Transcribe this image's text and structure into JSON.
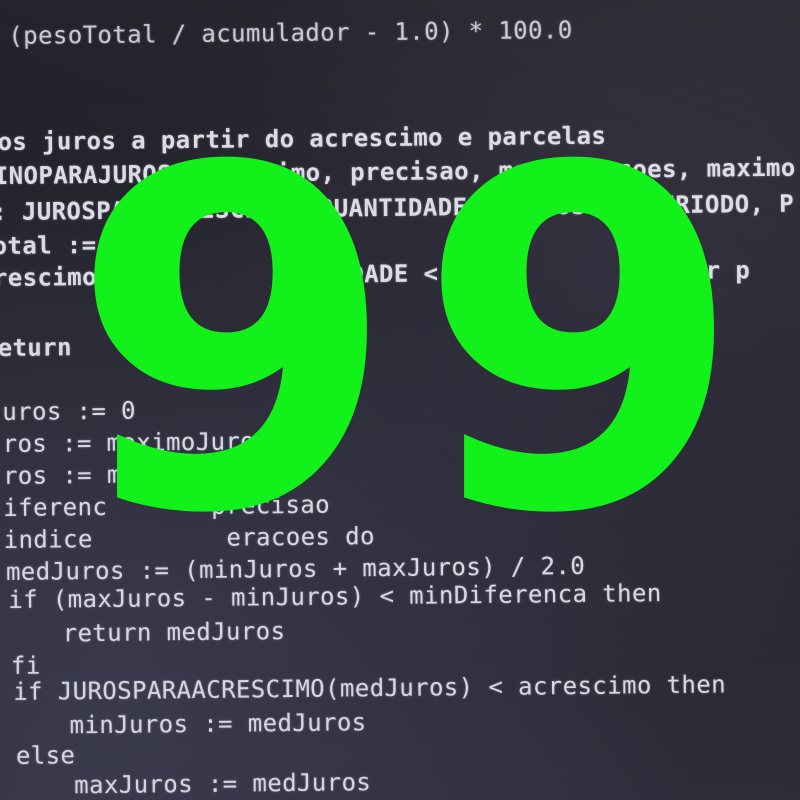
{
  "code_lines": [
    "(pesoTotal / acumulador - 1.0) * 100.0",
    "os juros a partir do acrescimo e parcelas",
    "INOPARAJUROS(acrescimo, precisao, maxIteracoes, maximo",
    ": JUROSPARAACRESCIMO, QUANTIDADE, COMPOSTO, PERIODO, P",
    "otal := GE",
    "rescimo                IDADE <             0.0 or p",
    "eturn",
    "uros := 0",
    "ros := maximoJuros",
    "ros := maximoJuros",
    "iferenc       precisao",
    "indice         eracoes do",
    "medJuros := (minJuros + maxJuros) / 2.0",
    "if (maxJuros - minJuros) < minDiferenca then",
    "return medJuros",
    "fi",
    "if JUROSPARAACRESCIMO(medJuros) < acrescimo then",
    "minJuros := medJuros",
    "else",
    "maxJuros := medJuros"
  ],
  "overlay": {
    "number": "99",
    "color": "#12f21a"
  },
  "colors": {
    "screen_background": "#24242c",
    "code_text": "#dcdce6"
  }
}
